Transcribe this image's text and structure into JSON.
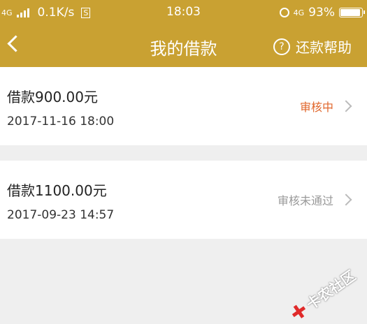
{
  "status_bar": {
    "network": "4G",
    "speed": "0.1K/s",
    "speed_box": "S",
    "time": "18:03",
    "network_right": "4G",
    "battery": "93%",
    "battery_level": 0.93
  },
  "navbar": {
    "title": "我的借款",
    "help_label": "还款帮助",
    "help_icon": "?"
  },
  "loans": [
    {
      "amount": "借款900.00元",
      "date": "2017-11-16 18:00",
      "status": "审核中"
    },
    {
      "amount": "借款1100.00元",
      "date": "2017-09-23 14:57",
      "status": "审核未通过"
    }
  ],
  "watermark": {
    "text": "卡农社区"
  },
  "colors": {
    "header": "#c9a132",
    "pending": "#e0662b",
    "rejected": "#999999"
  }
}
